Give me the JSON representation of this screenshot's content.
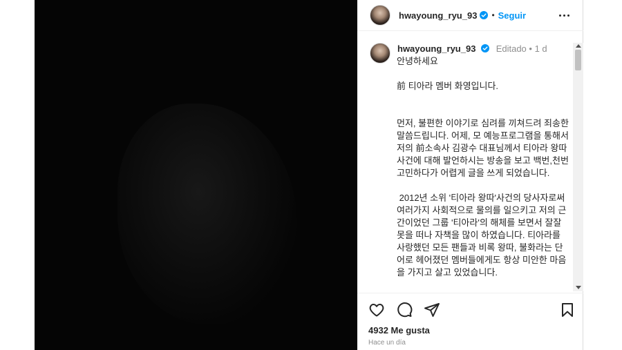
{
  "post": {
    "username": "hwayoung_ryu_93",
    "follow_label": "Seguir",
    "separator": "•",
    "edited_label": "Editado",
    "caption_time": "1 d",
    "caption_text": "안녕하세요\n\n前 티아라 멤버 화영입니다.\n\n\n먼저, 불편한 이야기로 심려를 끼쳐드려 죄송한 말씀드립니다. 어제, 모 예능프로그램을 통해서 저의 前소속사 김광수 대표님께서 티아라 왕따 사건에 대해 발언하시는 방송을 보고 백번,천번 고민하다가 어렵게 글을 쓰게 되었습니다.\n\n 2012년 소위 '티아라 왕따'사건의 당사자로써 여러가지 사회적으로 물의를 일으키고 저의 근간이었던 그룹 '티아라'의 해체를 보면서 잘잘못을 떠나 자책을 많이 하였습니다. 티아라를 사랑했던 모든 팬들과 비록 왕따, 불화라는 단어로 헤어졌던 멤버들에게도 항상 미안한 마음을 가지고 살고 있었습니다.",
    "likes": "4932 Me gusta",
    "time_ago": "Hace un día"
  },
  "icons": {
    "verified": "verified-badge-icon",
    "more": "more-options-icon",
    "like": "heart-icon",
    "comment": "comment-icon",
    "share": "share-icon",
    "save": "bookmark-icon"
  },
  "colors": {
    "accent": "#0095f6",
    "text": "#262626",
    "muted": "#8e8e8e",
    "media_bg": "#050505"
  }
}
